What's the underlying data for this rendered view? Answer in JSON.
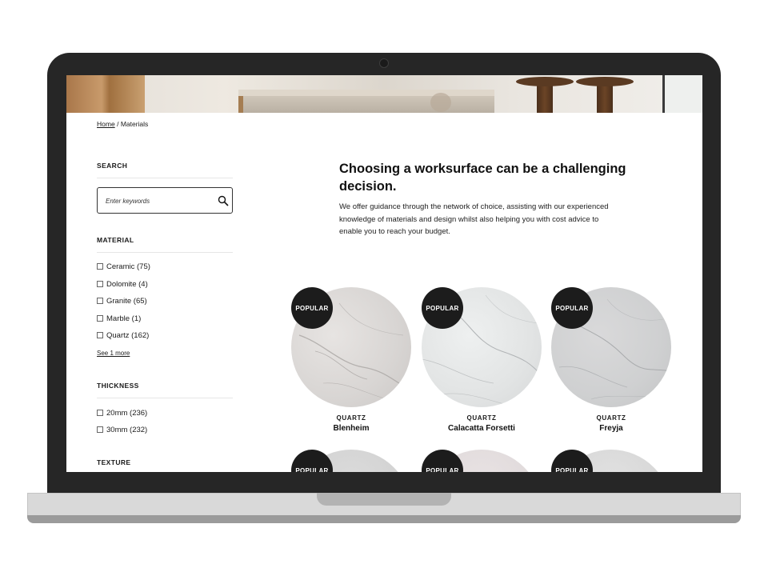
{
  "breadcrumb": {
    "home": "Home",
    "separator": "/",
    "current": "Materials"
  },
  "search": {
    "title": "SEARCH",
    "placeholder": "Enter keywords",
    "icon": "search-icon"
  },
  "material": {
    "title": "MATERIAL",
    "options": [
      "Ceramic (75)",
      "Dolomite (4)",
      "Granite (65)",
      "Marble (1)",
      "Quartz (162)"
    ],
    "see_more": "See 1 more"
  },
  "thickness": {
    "title": "THICKNESS",
    "options": [
      "20mm (236)",
      "30mm (232)"
    ]
  },
  "texture": {
    "title": "TEXTURE"
  },
  "main": {
    "heading": "Choosing a worksurface can be a challenging decision.",
    "intro": "We offer guidance through the network of choice, assisting with our experienced knowledge of materials and design whilst also helping you with cost advice to enable you to reach your budget."
  },
  "products": [
    {
      "badge": "POPULAR",
      "category": "QUARTZ",
      "name": "Blenheim"
    },
    {
      "badge": "POPULAR",
      "category": "QUARTZ",
      "name": "Calacatta Forsetti"
    },
    {
      "badge": "POPULAR",
      "category": "QUARTZ",
      "name": "Freyja"
    }
  ],
  "products_row2": [
    {
      "badge": "POPULAR"
    },
    {
      "badge": "POPULAR"
    },
    {
      "badge": "POPULAR"
    }
  ],
  "colors": {
    "badge": "#1c1c1c",
    "bezel": "#262626",
    "text": "#1a1a1a"
  }
}
